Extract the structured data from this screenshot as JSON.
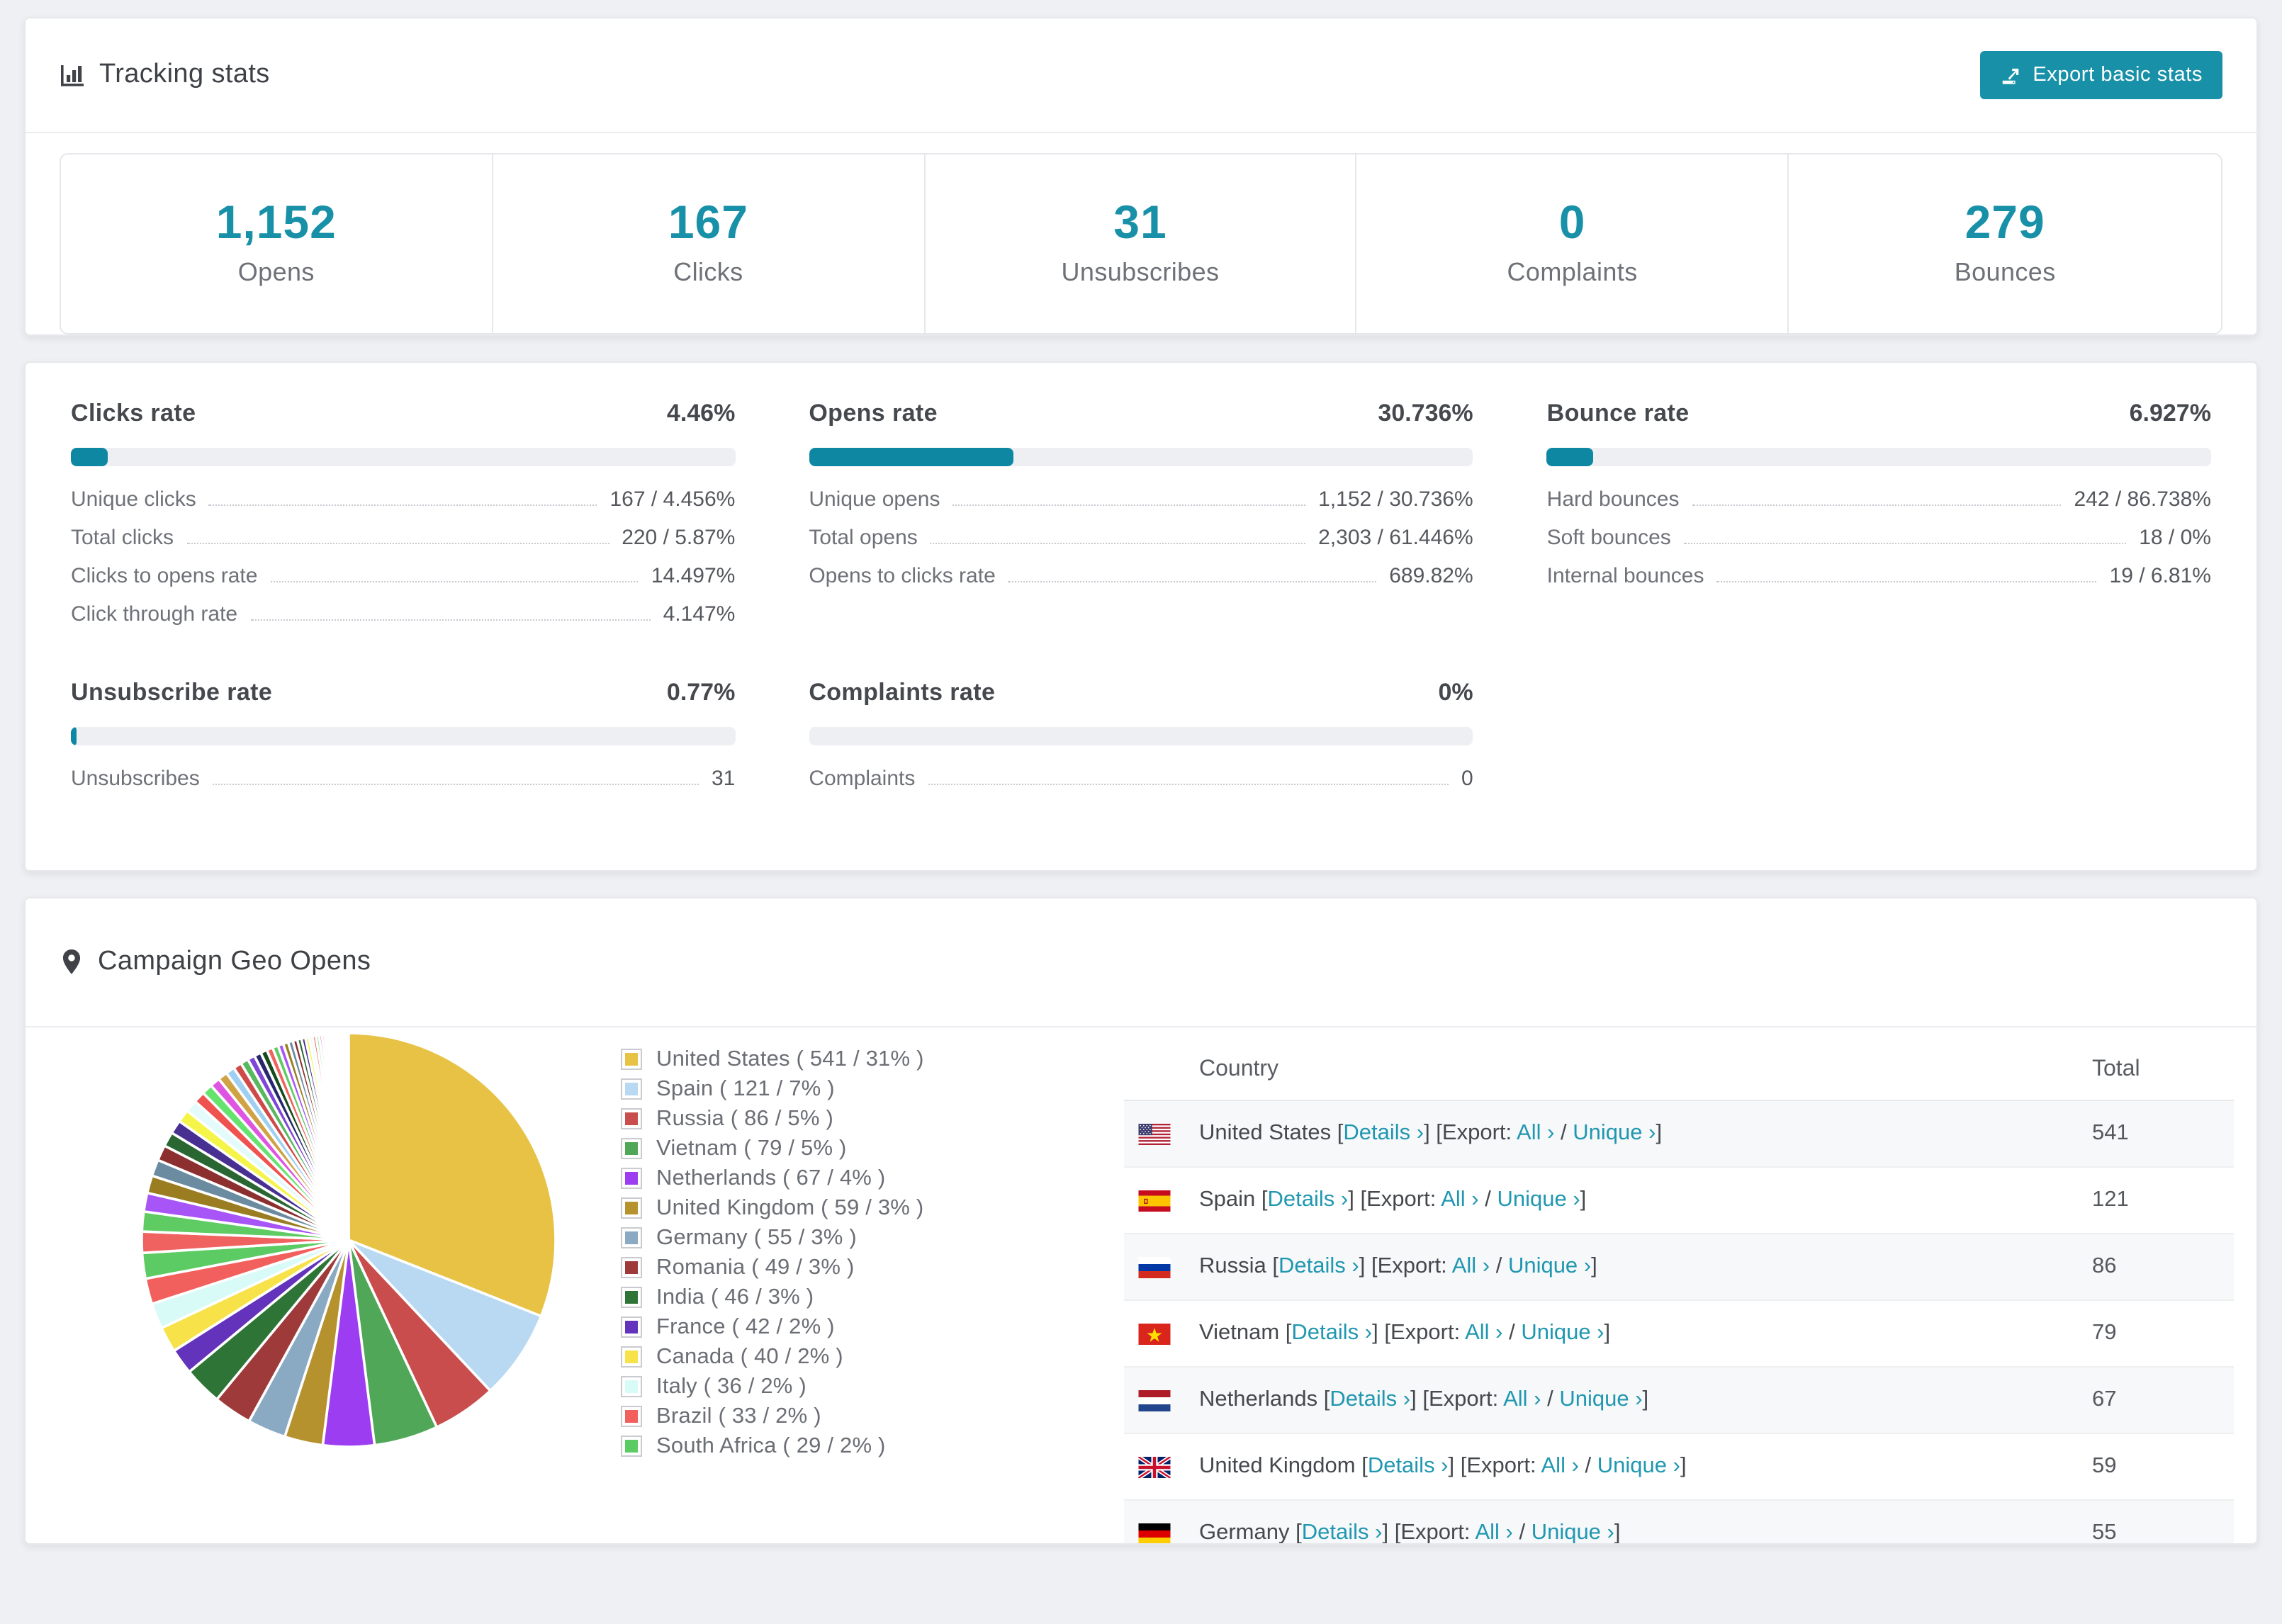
{
  "colors": {
    "accent": "#1790a8",
    "bar_fill": "#0e88a2",
    "link": "#2097b1",
    "page_background": "#eef0f3"
  },
  "tracking": {
    "title": "Tracking stats",
    "export_label": "Export basic stats"
  },
  "summary": [
    {
      "value": "1,152",
      "label": "Opens"
    },
    {
      "value": "167",
      "label": "Clicks"
    },
    {
      "value": "31",
      "label": "Unsubscribes"
    },
    {
      "value": "0",
      "label": "Complaints"
    },
    {
      "value": "279",
      "label": "Bounces"
    }
  ],
  "rates": [
    {
      "title": "Clicks rate",
      "value": "4.46%",
      "bar_pct": 4.46,
      "rows": [
        [
          "Unique clicks",
          "167 / 4.456%"
        ],
        [
          "Total clicks",
          "220 / 5.87%"
        ],
        [
          "Clicks to opens rate",
          "14.497%"
        ],
        [
          "Click through rate",
          "4.147%"
        ]
      ]
    },
    {
      "title": "Opens rate",
      "value": "30.736%",
      "bar_pct": 30.736,
      "rows": [
        [
          "Unique opens",
          "1,152 / 30.736%"
        ],
        [
          "Total opens",
          "2,303 / 61.446%"
        ],
        [
          "Opens to clicks rate",
          "689.82%"
        ]
      ]
    },
    {
      "title": "Bounce rate",
      "value": "6.927%",
      "bar_pct": 6.927,
      "rows": [
        [
          "Hard bounces",
          "242 / 86.738%"
        ],
        [
          "Soft bounces",
          "18 / 0%"
        ],
        [
          "Internal bounces",
          "19 / 6.81%"
        ]
      ]
    },
    {
      "title": "Unsubscribe rate",
      "value": "0.77%",
      "bar_pct": 0.77,
      "rows": [
        [
          "Unsubscribes",
          "31"
        ]
      ]
    },
    {
      "title": "Complaints rate",
      "value": "0%",
      "bar_pct": 0,
      "rows": [
        [
          "Complaints",
          "0"
        ]
      ]
    }
  ],
  "geo": {
    "title": "Campaign Geo Opens",
    "table_headers": [
      "Country",
      "Total"
    ],
    "links": {
      "details": "Details ›",
      "export_word": "Export:",
      "all": "All ›",
      "separator": "/",
      "unique": "Unique ›"
    },
    "rows": [
      {
        "country": "United States",
        "flag": "us",
        "total": "541"
      },
      {
        "country": "Spain",
        "flag": "es",
        "total": "121"
      },
      {
        "country": "Russia",
        "flag": "ru",
        "total": "86"
      },
      {
        "country": "Vietnam",
        "flag": "vn",
        "total": "79"
      },
      {
        "country": "Netherlands",
        "flag": "nl",
        "total": "67"
      },
      {
        "country": "United Kingdom",
        "flag": "gb",
        "total": "59"
      },
      {
        "country": "Germany",
        "flag": "de",
        "total": "55",
        "partially_visible": true
      }
    ]
  },
  "chart_data": {
    "type": "pie",
    "title": "Campaign Geo Opens",
    "unit": "opens",
    "legend_position": "right",
    "start_angle_deg": 0,
    "direction": "clockwise",
    "slices": [
      {
        "label": "United States",
        "value": 541,
        "percent": 31,
        "color": "#e7c244"
      },
      {
        "label": "Spain",
        "value": 121,
        "percent": 7,
        "color": "#b8d9f1"
      },
      {
        "label": "Russia",
        "value": 86,
        "percent": 5,
        "color": "#c94d4d"
      },
      {
        "label": "Vietnam",
        "value": 79,
        "percent": 5,
        "color": "#4fa757"
      },
      {
        "label": "Netherlands",
        "value": 67,
        "percent": 4,
        "color": "#9c3df2"
      },
      {
        "label": "United Kingdom",
        "value": 59,
        "percent": 3,
        "color": "#b6922e"
      },
      {
        "label": "Germany",
        "value": 55,
        "percent": 3,
        "color": "#8aa9c2"
      },
      {
        "label": "Romania",
        "value": 49,
        "percent": 3,
        "color": "#9e3a3a"
      },
      {
        "label": "India",
        "value": 46,
        "percent": 3,
        "color": "#2d7436"
      },
      {
        "label": "France",
        "value": 42,
        "percent": 2,
        "color": "#6333bb"
      },
      {
        "label": "Canada",
        "value": 40,
        "percent": 2,
        "color": "#f8e24a"
      },
      {
        "label": "Italy",
        "value": 36,
        "percent": 2,
        "color": "#d9fbf8"
      },
      {
        "label": "Brazil",
        "value": 33,
        "percent": 2,
        "color": "#f2605d"
      },
      {
        "label": "South Africa",
        "value": 29,
        "percent": 2,
        "color": "#5dcb63"
      }
    ],
    "other_slices": {
      "description": "many small unlabeled country slices tapering to hairlines",
      "approx_total_percent": 26
    },
    "legend_entry_format": "{label} ( {value} / {percent}% )"
  }
}
